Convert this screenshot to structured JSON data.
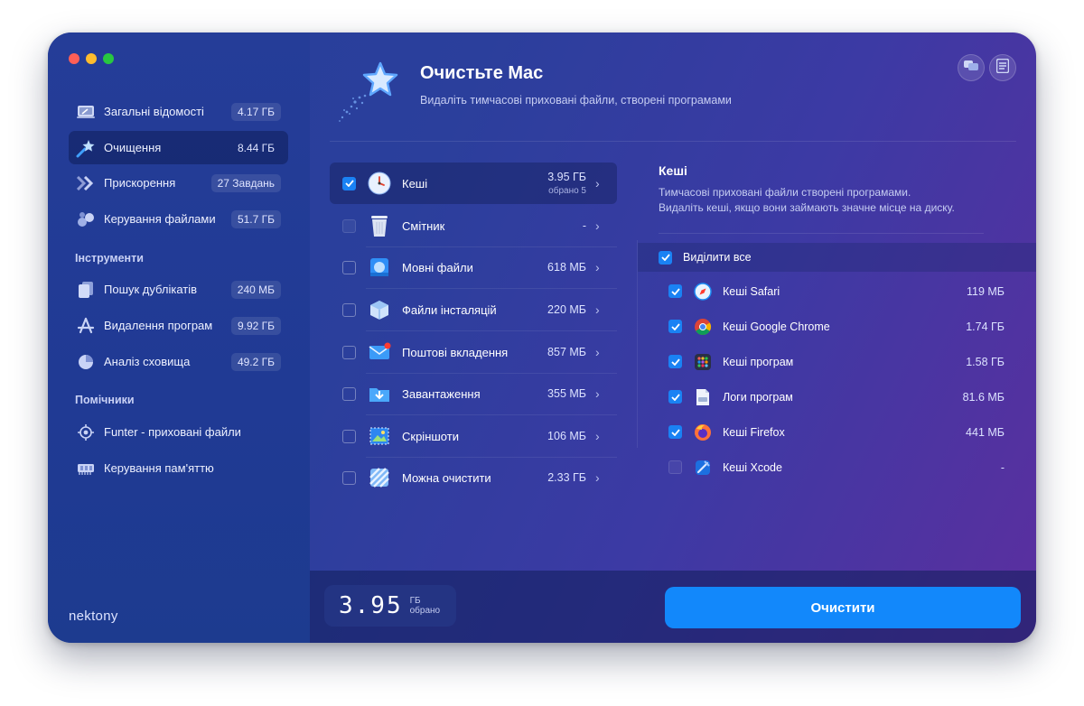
{
  "sidebar": {
    "items": [
      {
        "label": "Загальні відомості",
        "badge": "4.17 ГБ"
      },
      {
        "label": "Очищення",
        "badge": "8.44 ГБ"
      },
      {
        "label": "Прискорення",
        "badge": "27 Завдань"
      },
      {
        "label": "Керування файлами",
        "badge": "51.7 ГБ"
      }
    ],
    "tools_title": "Інструменти",
    "tools": [
      {
        "label": "Пошук дублікатів",
        "badge": "240 МБ"
      },
      {
        "label": "Видалення програм",
        "badge": "9.92 ГБ"
      },
      {
        "label": "Аналіз сховища",
        "badge": "49.2 ГБ"
      }
    ],
    "helpers_title": "Помічники",
    "helpers": [
      {
        "label": "Funter - приховані файли"
      },
      {
        "label": "Керування пам'яттю"
      }
    ],
    "brand": "nektony"
  },
  "header": {
    "title": "Очистьте Mac",
    "subtitle": "Видаліть тимчасові приховані файли, створені програмами"
  },
  "categories": [
    {
      "label": "Кеші",
      "size": "3.95 ГБ",
      "sub": "обрано 5",
      "checked": true
    },
    {
      "label": "Смітник",
      "size": "-",
      "checked": false
    },
    {
      "label": "Мовні файли",
      "size": "618 МБ",
      "checked": false
    },
    {
      "label": "Файли інсталяцій",
      "size": "220 МБ",
      "checked": false
    },
    {
      "label": "Поштові вкладення",
      "size": "857 МБ",
      "checked": false
    },
    {
      "label": "Завантаження",
      "size": "355 МБ",
      "checked": false
    },
    {
      "label": "Скріншоти",
      "size": "106 МБ",
      "checked": false
    },
    {
      "label": "Можна очистити",
      "size": "2.33 ГБ",
      "checked": false
    }
  ],
  "detail": {
    "title": "Кеші",
    "desc_line1": "Тимчасові приховані файли створені програмами.",
    "desc_line2": "Видаліть кеші, якщо вони займають значне місце на диску.",
    "select_all": "Виділити все",
    "items": [
      {
        "label": "Кеші Safari",
        "size": "119 МБ",
        "checked": true
      },
      {
        "label": "Кеші Google Chrome",
        "size": "1.74 ГБ",
        "checked": true
      },
      {
        "label": "Кеші програм",
        "size": "1.58 ГБ",
        "checked": true
      },
      {
        "label": "Логи програм",
        "size": "81.6 МБ",
        "checked": true
      },
      {
        "label": "Кеші Firefox",
        "size": "441 МБ",
        "checked": true
      },
      {
        "label": "Кеші Xcode",
        "size": "-",
        "checked": false
      }
    ]
  },
  "footer": {
    "amount": "3.95",
    "unit": "ГБ",
    "unit_sub": "обрано",
    "clean_button": "Очистити"
  },
  "colors": {
    "accent": "#1288fb",
    "checkbox": "#1a82f4"
  }
}
